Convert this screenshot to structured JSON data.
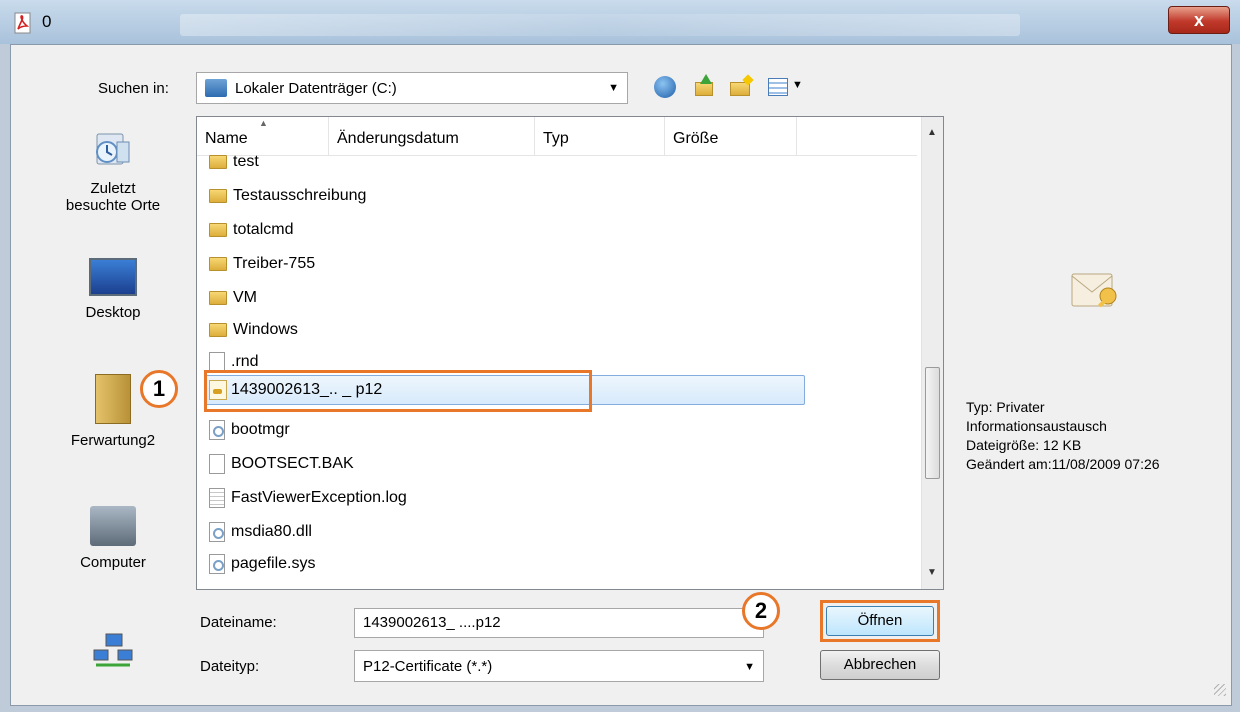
{
  "window": {
    "title": "0",
    "close_label": "x"
  },
  "look_in": {
    "label": "Suchen in:",
    "value": "Lokaler Datenträger (C:)"
  },
  "places": [
    {
      "label": "Zuletzt\nbesuchte Orte",
      "line1": "Zuletzt",
      "line2": "besuchte Orte"
    },
    {
      "label": "Desktop"
    },
    {
      "label": "Ferwartung2"
    },
    {
      "label": "Computer"
    },
    {
      "label": "Netzwerk"
    }
  ],
  "columns": [
    "Name",
    "Änderungsdatum",
    "Typ",
    "Größe"
  ],
  "files": [
    {
      "name": "test",
      "kind": "folder"
    },
    {
      "name": "Testausschreibung",
      "kind": "folder"
    },
    {
      "name": "totalcmd",
      "kind": "folder"
    },
    {
      "name": "Treiber-755",
      "kind": "folder"
    },
    {
      "name": "VM",
      "kind": "folder"
    },
    {
      "name": "Windows",
      "kind": "folder"
    },
    {
      "name": ".rnd",
      "kind": "file"
    },
    {
      "name": "1439002613_..        _              p12",
      "kind": "cert",
      "selected": true
    },
    {
      "name": "bootmgr",
      "kind": "system"
    },
    {
      "name": "BOOTSECT.BAK",
      "kind": "file"
    },
    {
      "name": "FastViewerException.log",
      "kind": "log"
    },
    {
      "name": "msdia80.dll",
      "kind": "system"
    },
    {
      "name": "pagefile.sys",
      "kind": "system"
    }
  ],
  "filename": {
    "label": "Dateiname:",
    "value": "1439002613_                    ....p12"
  },
  "filetype": {
    "label": "Dateityp:",
    "value": "P12-Certificate (*.*)"
  },
  "buttons": {
    "open": "Öffnen",
    "cancel": "Abbrechen"
  },
  "preview": {
    "type_line": "Typ: Privater",
    "type_line2": "Informationsaustausch",
    "size_line": "Dateigröße: 12 KB",
    "modified_line": "Geändert am:11/08/2009 07:26"
  },
  "annotations": {
    "step1": "1",
    "step2": "2",
    "accent_color": "#e8772a"
  }
}
